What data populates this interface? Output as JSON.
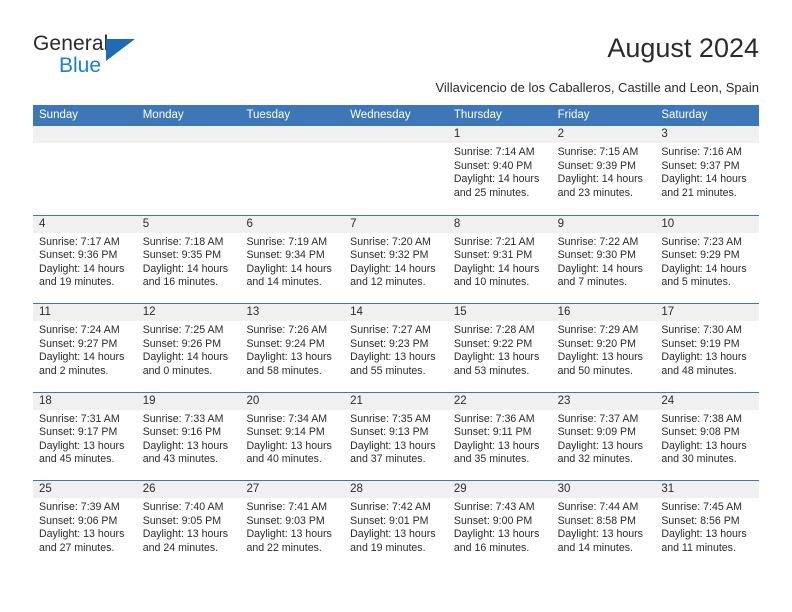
{
  "brand": {
    "name_top": "General",
    "name_bottom": "Blue",
    "accent_color": "#1b7fd4",
    "triangle_color": "#1f6cb4"
  },
  "header": {
    "title": "August 2024",
    "subtitle": "Villavicencio de los Caballeros, Castille and Leon, Spain"
  },
  "calendar": {
    "header_bg": "#3d77b8",
    "day_number_bg": "#f0f0f0",
    "weekdays": [
      "Sunday",
      "Monday",
      "Tuesday",
      "Wednesday",
      "Thursday",
      "Friday",
      "Saturday"
    ],
    "weeks": [
      [
        {
          "day": "",
          "empty": true,
          "sunrise": "",
          "sunset": "",
          "daylight_line1": "",
          "daylight_line2": ""
        },
        {
          "day": "",
          "empty": true,
          "sunrise": "",
          "sunset": "",
          "daylight_line1": "",
          "daylight_line2": ""
        },
        {
          "day": "",
          "empty": true,
          "sunrise": "",
          "sunset": "",
          "daylight_line1": "",
          "daylight_line2": ""
        },
        {
          "day": "",
          "empty": true,
          "sunrise": "",
          "sunset": "",
          "daylight_line1": "",
          "daylight_line2": ""
        },
        {
          "day": "1",
          "empty": false,
          "sunrise": "Sunrise: 7:14 AM",
          "sunset": "Sunset: 9:40 PM",
          "daylight_line1": "Daylight: 14 hours",
          "daylight_line2": "and 25 minutes."
        },
        {
          "day": "2",
          "empty": false,
          "sunrise": "Sunrise: 7:15 AM",
          "sunset": "Sunset: 9:39 PM",
          "daylight_line1": "Daylight: 14 hours",
          "daylight_line2": "and 23 minutes."
        },
        {
          "day": "3",
          "empty": false,
          "sunrise": "Sunrise: 7:16 AM",
          "sunset": "Sunset: 9:37 PM",
          "daylight_line1": "Daylight: 14 hours",
          "daylight_line2": "and 21 minutes."
        }
      ],
      [
        {
          "day": "4",
          "empty": false,
          "sunrise": "Sunrise: 7:17 AM",
          "sunset": "Sunset: 9:36 PM",
          "daylight_line1": "Daylight: 14 hours",
          "daylight_line2": "and 19 minutes."
        },
        {
          "day": "5",
          "empty": false,
          "sunrise": "Sunrise: 7:18 AM",
          "sunset": "Sunset: 9:35 PM",
          "daylight_line1": "Daylight: 14 hours",
          "daylight_line2": "and 16 minutes."
        },
        {
          "day": "6",
          "empty": false,
          "sunrise": "Sunrise: 7:19 AM",
          "sunset": "Sunset: 9:34 PM",
          "daylight_line1": "Daylight: 14 hours",
          "daylight_line2": "and 14 minutes."
        },
        {
          "day": "7",
          "empty": false,
          "sunrise": "Sunrise: 7:20 AM",
          "sunset": "Sunset: 9:32 PM",
          "daylight_line1": "Daylight: 14 hours",
          "daylight_line2": "and 12 minutes."
        },
        {
          "day": "8",
          "empty": false,
          "sunrise": "Sunrise: 7:21 AM",
          "sunset": "Sunset: 9:31 PM",
          "daylight_line1": "Daylight: 14 hours",
          "daylight_line2": "and 10 minutes."
        },
        {
          "day": "9",
          "empty": false,
          "sunrise": "Sunrise: 7:22 AM",
          "sunset": "Sunset: 9:30 PM",
          "daylight_line1": "Daylight: 14 hours",
          "daylight_line2": "and 7 minutes."
        },
        {
          "day": "10",
          "empty": false,
          "sunrise": "Sunrise: 7:23 AM",
          "sunset": "Sunset: 9:29 PM",
          "daylight_line1": "Daylight: 14 hours",
          "daylight_line2": "and 5 minutes."
        }
      ],
      [
        {
          "day": "11",
          "empty": false,
          "sunrise": "Sunrise: 7:24 AM",
          "sunset": "Sunset: 9:27 PM",
          "daylight_line1": "Daylight: 14 hours",
          "daylight_line2": "and 2 minutes."
        },
        {
          "day": "12",
          "empty": false,
          "sunrise": "Sunrise: 7:25 AM",
          "sunset": "Sunset: 9:26 PM",
          "daylight_line1": "Daylight: 14 hours",
          "daylight_line2": "and 0 minutes."
        },
        {
          "day": "13",
          "empty": false,
          "sunrise": "Sunrise: 7:26 AM",
          "sunset": "Sunset: 9:24 PM",
          "daylight_line1": "Daylight: 13 hours",
          "daylight_line2": "and 58 minutes."
        },
        {
          "day": "14",
          "empty": false,
          "sunrise": "Sunrise: 7:27 AM",
          "sunset": "Sunset: 9:23 PM",
          "daylight_line1": "Daylight: 13 hours",
          "daylight_line2": "and 55 minutes."
        },
        {
          "day": "15",
          "empty": false,
          "sunrise": "Sunrise: 7:28 AM",
          "sunset": "Sunset: 9:22 PM",
          "daylight_line1": "Daylight: 13 hours",
          "daylight_line2": "and 53 minutes."
        },
        {
          "day": "16",
          "empty": false,
          "sunrise": "Sunrise: 7:29 AM",
          "sunset": "Sunset: 9:20 PM",
          "daylight_line1": "Daylight: 13 hours",
          "daylight_line2": "and 50 minutes."
        },
        {
          "day": "17",
          "empty": false,
          "sunrise": "Sunrise: 7:30 AM",
          "sunset": "Sunset: 9:19 PM",
          "daylight_line1": "Daylight: 13 hours",
          "daylight_line2": "and 48 minutes."
        }
      ],
      [
        {
          "day": "18",
          "empty": false,
          "sunrise": "Sunrise: 7:31 AM",
          "sunset": "Sunset: 9:17 PM",
          "daylight_line1": "Daylight: 13 hours",
          "daylight_line2": "and 45 minutes."
        },
        {
          "day": "19",
          "empty": false,
          "sunrise": "Sunrise: 7:33 AM",
          "sunset": "Sunset: 9:16 PM",
          "daylight_line1": "Daylight: 13 hours",
          "daylight_line2": "and 43 minutes."
        },
        {
          "day": "20",
          "empty": false,
          "sunrise": "Sunrise: 7:34 AM",
          "sunset": "Sunset: 9:14 PM",
          "daylight_line1": "Daylight: 13 hours",
          "daylight_line2": "and 40 minutes."
        },
        {
          "day": "21",
          "empty": false,
          "sunrise": "Sunrise: 7:35 AM",
          "sunset": "Sunset: 9:13 PM",
          "daylight_line1": "Daylight: 13 hours",
          "daylight_line2": "and 37 minutes."
        },
        {
          "day": "22",
          "empty": false,
          "sunrise": "Sunrise: 7:36 AM",
          "sunset": "Sunset: 9:11 PM",
          "daylight_line1": "Daylight: 13 hours",
          "daylight_line2": "and 35 minutes."
        },
        {
          "day": "23",
          "empty": false,
          "sunrise": "Sunrise: 7:37 AM",
          "sunset": "Sunset: 9:09 PM",
          "daylight_line1": "Daylight: 13 hours",
          "daylight_line2": "and 32 minutes."
        },
        {
          "day": "24",
          "empty": false,
          "sunrise": "Sunrise: 7:38 AM",
          "sunset": "Sunset: 9:08 PM",
          "daylight_line1": "Daylight: 13 hours",
          "daylight_line2": "and 30 minutes."
        }
      ],
      [
        {
          "day": "25",
          "empty": false,
          "sunrise": "Sunrise: 7:39 AM",
          "sunset": "Sunset: 9:06 PM",
          "daylight_line1": "Daylight: 13 hours",
          "daylight_line2": "and 27 minutes."
        },
        {
          "day": "26",
          "empty": false,
          "sunrise": "Sunrise: 7:40 AM",
          "sunset": "Sunset: 9:05 PM",
          "daylight_line1": "Daylight: 13 hours",
          "daylight_line2": "and 24 minutes."
        },
        {
          "day": "27",
          "empty": false,
          "sunrise": "Sunrise: 7:41 AM",
          "sunset": "Sunset: 9:03 PM",
          "daylight_line1": "Daylight: 13 hours",
          "daylight_line2": "and 22 minutes."
        },
        {
          "day": "28",
          "empty": false,
          "sunrise": "Sunrise: 7:42 AM",
          "sunset": "Sunset: 9:01 PM",
          "daylight_line1": "Daylight: 13 hours",
          "daylight_line2": "and 19 minutes."
        },
        {
          "day": "29",
          "empty": false,
          "sunrise": "Sunrise: 7:43 AM",
          "sunset": "Sunset: 9:00 PM",
          "daylight_line1": "Daylight: 13 hours",
          "daylight_line2": "and 16 minutes."
        },
        {
          "day": "30",
          "empty": false,
          "sunrise": "Sunrise: 7:44 AM",
          "sunset": "Sunset: 8:58 PM",
          "daylight_line1": "Daylight: 13 hours",
          "daylight_line2": "and 14 minutes."
        },
        {
          "day": "31",
          "empty": false,
          "sunrise": "Sunrise: 7:45 AM",
          "sunset": "Sunset: 8:56 PM",
          "daylight_line1": "Daylight: 13 hours",
          "daylight_line2": "and 11 minutes."
        }
      ]
    ]
  }
}
